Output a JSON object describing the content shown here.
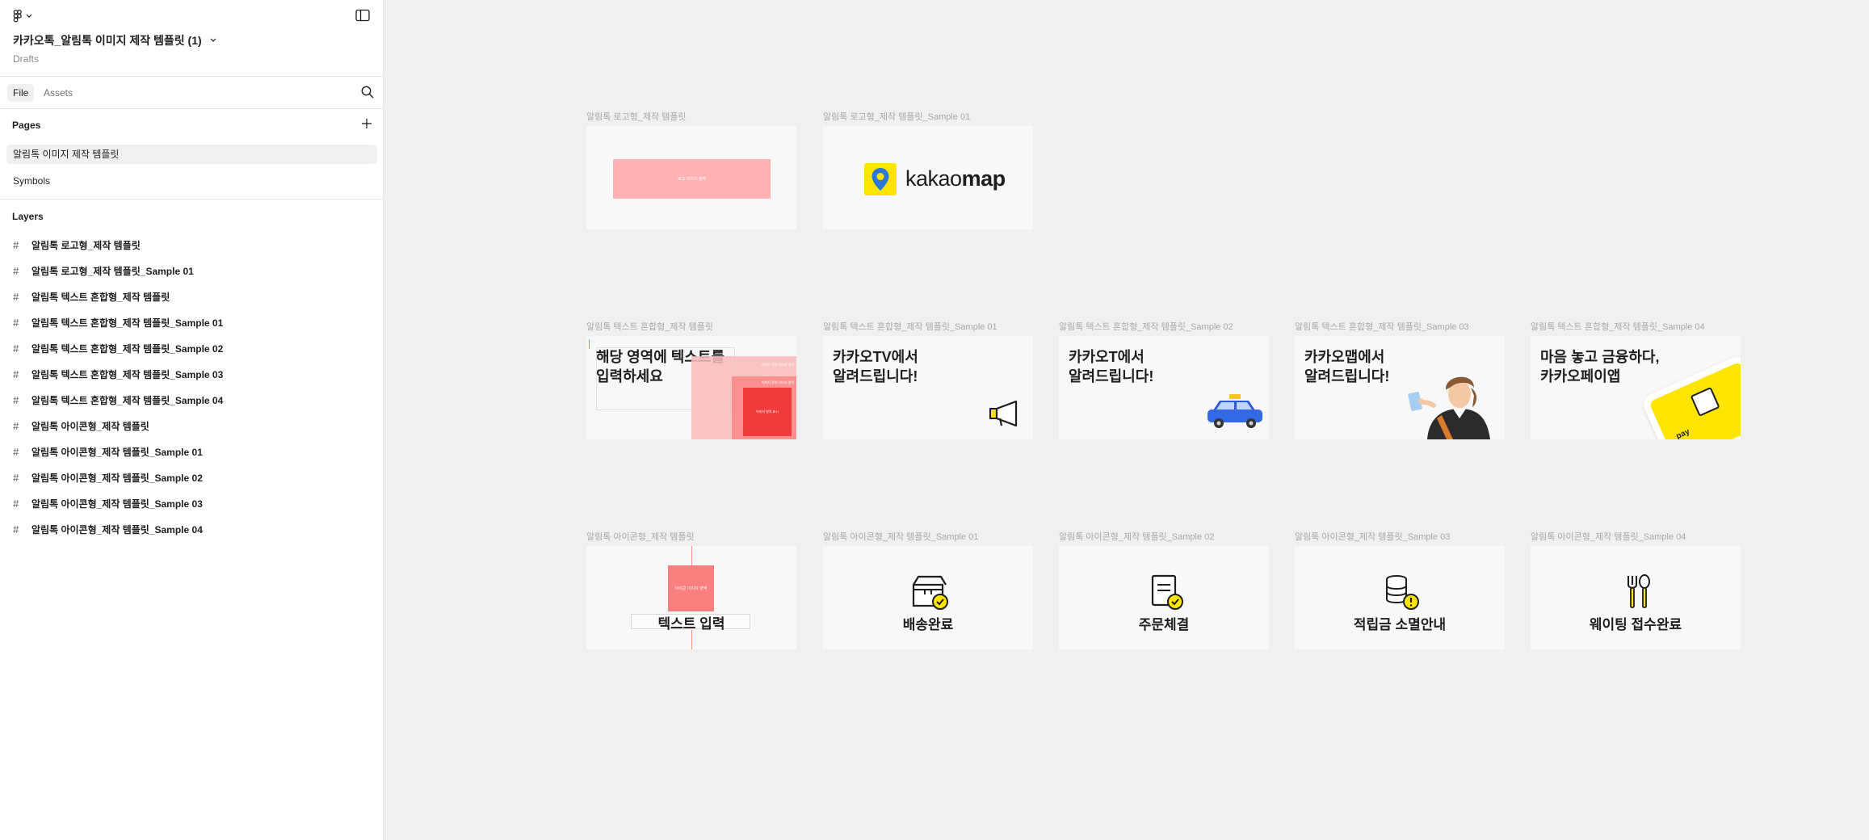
{
  "sidebar": {
    "file_title": "카카오톡_알림톡 이미지 제작 템플릿 (1)",
    "file_location": "Drafts",
    "tabs": [
      "File",
      "Assets"
    ],
    "pages_heading": "Pages",
    "pages": [
      "알림톡 이미지 제작 템플릿",
      "Symbols"
    ],
    "layers_heading": "Layers",
    "layers": [
      "알림톡 로고형_제작 템플릿",
      "알림톡 로고형_제작 템플릿_Sample 01",
      "알림톡 텍스트 혼합형_제작 템플릿",
      "알림톡 텍스트 혼합형_제작 템플릿_Sample 01",
      "알림톡 텍스트 혼합형_제작 템플릿_Sample 02",
      "알림톡 텍스트 혼합형_제작 템플릿_Sample 03",
      "알림톡 텍스트 혼합형_제작 템플릿_Sample 04",
      "알림톡 아이콘형_제작 템플릿",
      "알림톡 아이콘형_제작 템플릿_Sample 01",
      "알림톡 아이콘형_제작 템플릿_Sample 02",
      "알림톡 아이콘형_제작 템플릿_Sample 03",
      "알림톡 아이콘형_제작 템플릿_Sample 04"
    ]
  },
  "canvas": {
    "logo_row": {
      "labels": [
        "알림톡 로고형_제작 템플릿",
        "알림톡 로고형_제작 템플릿_Sample 01"
      ],
      "placeholder_text": "로고 이미지 영역",
      "kakaomap_light": "kakao",
      "kakaomap_bold": "map"
    },
    "text_row": {
      "labels": [
        "알림톡 텍스트 혼합형_제작 템플릿",
        "알림톡 텍스트 혼합형_제작 템플릿_Sample 01",
        "알림톡 텍스트 혼합형_제작 템플릿_Sample 02",
        "알림톡 텍스트 혼합형_제작 템플릿_Sample 03",
        "알림톡 텍스트 혼합형_제작 템플릿_Sample 04"
      ],
      "template_title_1": "해당 영역에 텍스트를",
      "template_title_2": "입력하세요",
      "zone_text_1": "이미지 영역 이미지 영역",
      "zone_text_2": "이미지 영역 이미지 영역",
      "zone_text_3": "이미지 영역 표시",
      "samples": [
        {
          "line1": "카카오TV에서",
          "line2": "알려드립니다!"
        },
        {
          "line1": "카카오T에서",
          "line2": "알려드립니다!"
        },
        {
          "line1": "카카오맵에서",
          "line2": "알려드립니다!"
        },
        {
          "line1": "마음 놓고 금융하다,",
          "line2": "카카오페이앱"
        }
      ],
      "pay_label": "pay"
    },
    "icon_row": {
      "labels": [
        "알림톡 아이콘형_제작 템플릿",
        "알림톡 아이콘형_제작 템플릿_Sample 01",
        "알림톡 아이콘형_제작 템플릿_Sample 02",
        "알림톡 아이콘형_제작 템플릿_Sample 03",
        "알림톡 아이콘형_제작 템플릿_Sample 04"
      ],
      "template_icon_text": "아이콘 이미지 영역",
      "template_caption": "텍스트 입력",
      "samples": [
        "배송완료",
        "주문체결",
        "적립금 소멸안내",
        "웨이팅 접수완료"
      ],
      "icons": [
        "delivery-box-icon",
        "order-document-icon",
        "coin-stack-icon",
        "fork-spoon-icon"
      ]
    }
  },
  "colors": {
    "kakao_yellow": "#fee500",
    "placeholder_pink": "#fdb3b3",
    "canvas_bg": "#f0f0f0",
    "frame_bg": "#f8f8f8"
  }
}
